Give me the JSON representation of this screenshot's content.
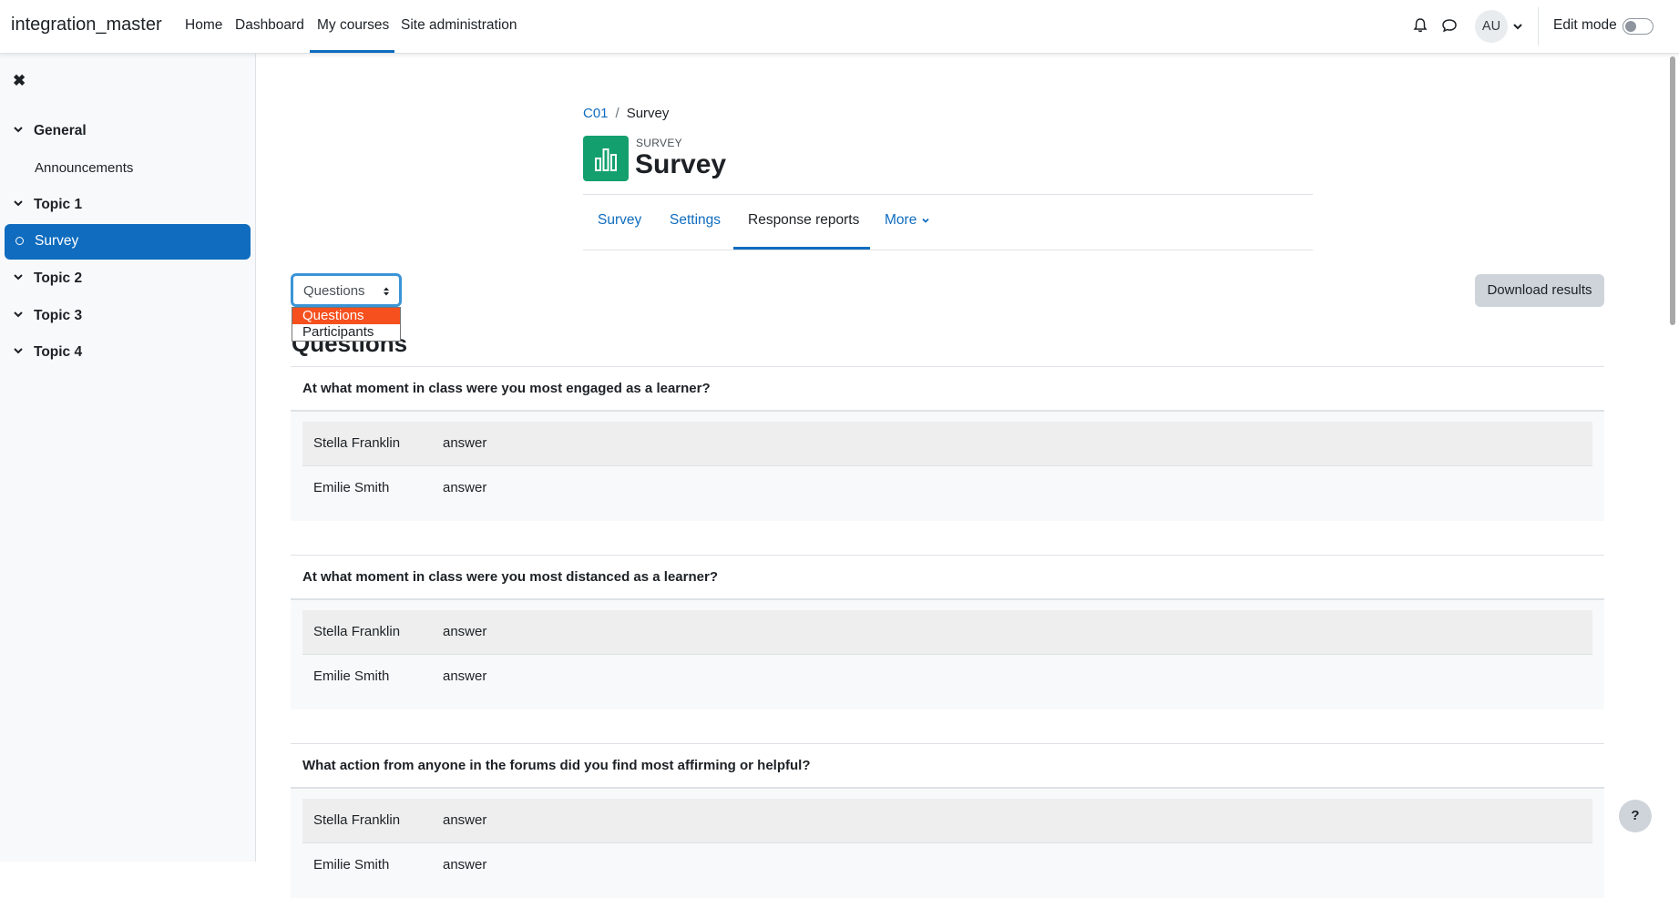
{
  "navbar": {
    "brand": "integration_master",
    "links": [
      "Home",
      "Dashboard",
      "My courses",
      "Site administration"
    ],
    "avatar_initials": "AU",
    "edit_mode_label": "Edit mode"
  },
  "drawer": {
    "sections": [
      {
        "label": "General",
        "items": [
          "Announcements"
        ]
      },
      {
        "label": "Topic 1",
        "items": [
          "Survey"
        ]
      },
      {
        "label": "Topic 2",
        "items": []
      },
      {
        "label": "Topic 3",
        "items": []
      },
      {
        "label": "Topic 4",
        "items": []
      }
    ],
    "active_item": "Survey"
  },
  "breadcrumb": {
    "course": "C01",
    "sep": "/",
    "current": "Survey"
  },
  "activity": {
    "type_label": "SURVEY",
    "title": "Survey",
    "icon_color": "#14a06e"
  },
  "tabs": [
    "Survey",
    "Settings",
    "Response reports",
    "More"
  ],
  "active_tab": "Response reports",
  "report_select": {
    "value": "Questions",
    "options": [
      "Questions",
      "Participants"
    ],
    "highlighted": "Questions"
  },
  "download_button": "Download results",
  "section_heading": "Questions",
  "questions": [
    {
      "text": "At what moment in class were you most engaged as a learner?",
      "responses": [
        {
          "name": "Stella Franklin",
          "answer": "answer"
        },
        {
          "name": "Emilie Smith",
          "answer": "answer"
        }
      ]
    },
    {
      "text": "At what moment in class were you most distanced as a learner?",
      "responses": [
        {
          "name": "Stella Franklin",
          "answer": "answer"
        },
        {
          "name": "Emilie Smith",
          "answer": "answer"
        }
      ]
    },
    {
      "text": "What action from anyone in the forums did you find most affirming or helpful?",
      "responses": [
        {
          "name": "Stella Franklin",
          "answer": "answer"
        },
        {
          "name": "Emilie Smith",
          "answer": "answer"
        }
      ]
    }
  ],
  "help_label": "?",
  "colors": {
    "primary": "#0f6cbf",
    "dropdown_highlight": "#f5501e",
    "survey_icon": "#14a06e"
  }
}
